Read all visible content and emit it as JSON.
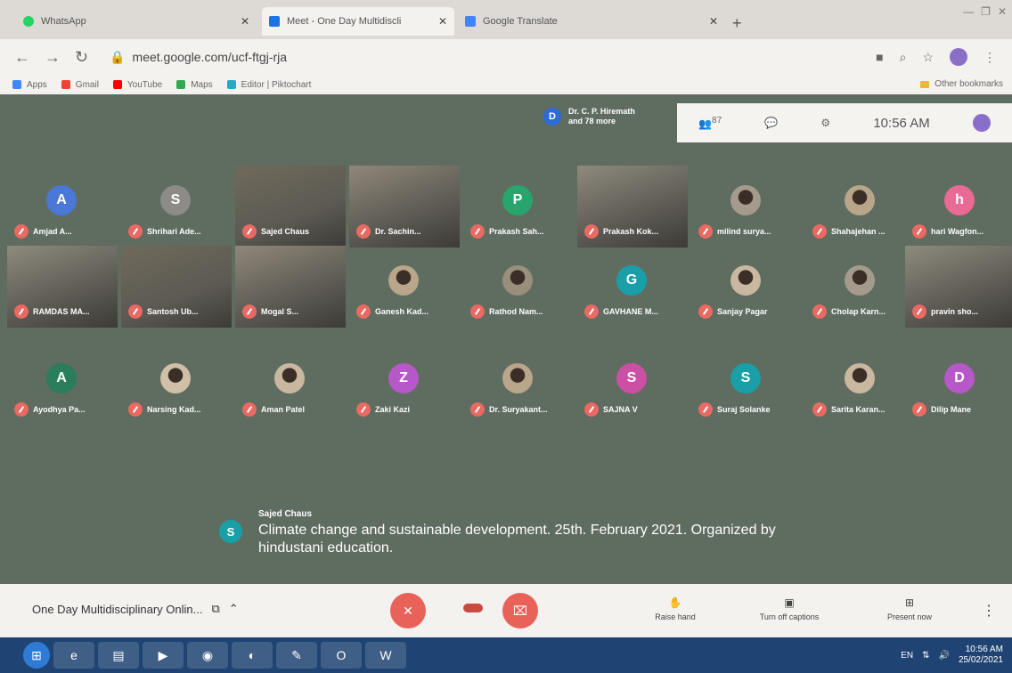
{
  "browser": {
    "tabs": [
      {
        "title": "WhatsApp",
        "color": "#25D366"
      },
      {
        "title": "Meet - One Day Multidiscli",
        "color": "#1a73e8"
      },
      {
        "title": "Google Translate",
        "color": "#4285f4"
      }
    ],
    "url": "meet.google.com/ucf-ftgj-rja",
    "bookmarks": [
      "Apps",
      "Gmail",
      "YouTube",
      "Maps",
      "Editor | Piktochart"
    ],
    "other_bookmarks": "Other bookmarks"
  },
  "meet": {
    "participants_summary": {
      "initial": "D",
      "line1": "Dr. C. P. Hiremath",
      "line2": "and 78 more"
    },
    "participant_count": "87",
    "clock": "10:56 AM",
    "tiles": [
      {
        "name": "Amjad A...",
        "initial": "A",
        "color": "#4a78d6",
        "type": "avatar"
      },
      {
        "name": "Shrihari Ade...",
        "initial": "S",
        "color": "#8d8b88",
        "type": "avatar"
      },
      {
        "name": "Sajed Chaus",
        "type": "video"
      },
      {
        "name": "Dr. Sachin...",
        "type": "video"
      },
      {
        "name": "Prakash Sah...",
        "initial": "P",
        "color": "#27a56d",
        "type": "avatar"
      },
      {
        "name": "Prakash Kok...",
        "type": "video"
      },
      {
        "name": "milind surya...",
        "type": "photo"
      },
      {
        "name": "Shahajehan ...",
        "type": "photo"
      },
      {
        "name": "hari Wagfon...",
        "initial": "h",
        "color": "#e86a95",
        "type": "avatar"
      },
      {
        "name": "RAMDAS MA...",
        "type": "video"
      },
      {
        "name": "Santosh Ub...",
        "type": "video"
      },
      {
        "name": "Mogal S...",
        "type": "video"
      },
      {
        "name": "Ganesh Kad...",
        "type": "photo"
      },
      {
        "name": "Rathod Nam...",
        "type": "photo"
      },
      {
        "name": "GAVHANE M...",
        "initial": "G",
        "color": "#1a9fa8",
        "type": "avatar"
      },
      {
        "name": "Sanjay Pagar",
        "type": "photo"
      },
      {
        "name": "Cholap Karn...",
        "type": "photo"
      },
      {
        "name": "pravin sho...",
        "type": "video"
      },
      {
        "name": "Ayodhya Pa...",
        "initial": "A",
        "color": "#2a7d5a",
        "type": "avatar"
      },
      {
        "name": "Narsing Kad...",
        "type": "photo"
      },
      {
        "name": "Aman Patel",
        "type": "photo"
      },
      {
        "name": "Zaki Kazi",
        "initial": "Z",
        "color": "#b658c7",
        "type": "avatar"
      },
      {
        "name": "Dr. Suryakant...",
        "type": "photo"
      },
      {
        "name": "SAJNA V",
        "initial": "S",
        "color": "#cc4fa6",
        "type": "avatar"
      },
      {
        "name": "Suraj Solanke",
        "initial": "S",
        "color": "#1a9fa8",
        "type": "avatar"
      },
      {
        "name": "Sarita Karan...",
        "type": "photo"
      },
      {
        "name": "Dilip Mane",
        "initial": "D",
        "color": "#b658c7",
        "type": "avatar"
      }
    ],
    "caption": {
      "speaker_initial": "S",
      "speaker": "Sajed Chaus",
      "text": "Climate change and sustainable development. 25th. February 2021. Organized by hindustani education."
    }
  },
  "controls": {
    "meeting_title": "One Day Multidisciplinary Onlin...",
    "raise_hand": "Raise hand",
    "captions": "Turn off captions",
    "present": "Present now"
  },
  "taskbar": {
    "lang": "EN",
    "time": "10:56 AM",
    "date": "25/02/2021"
  }
}
